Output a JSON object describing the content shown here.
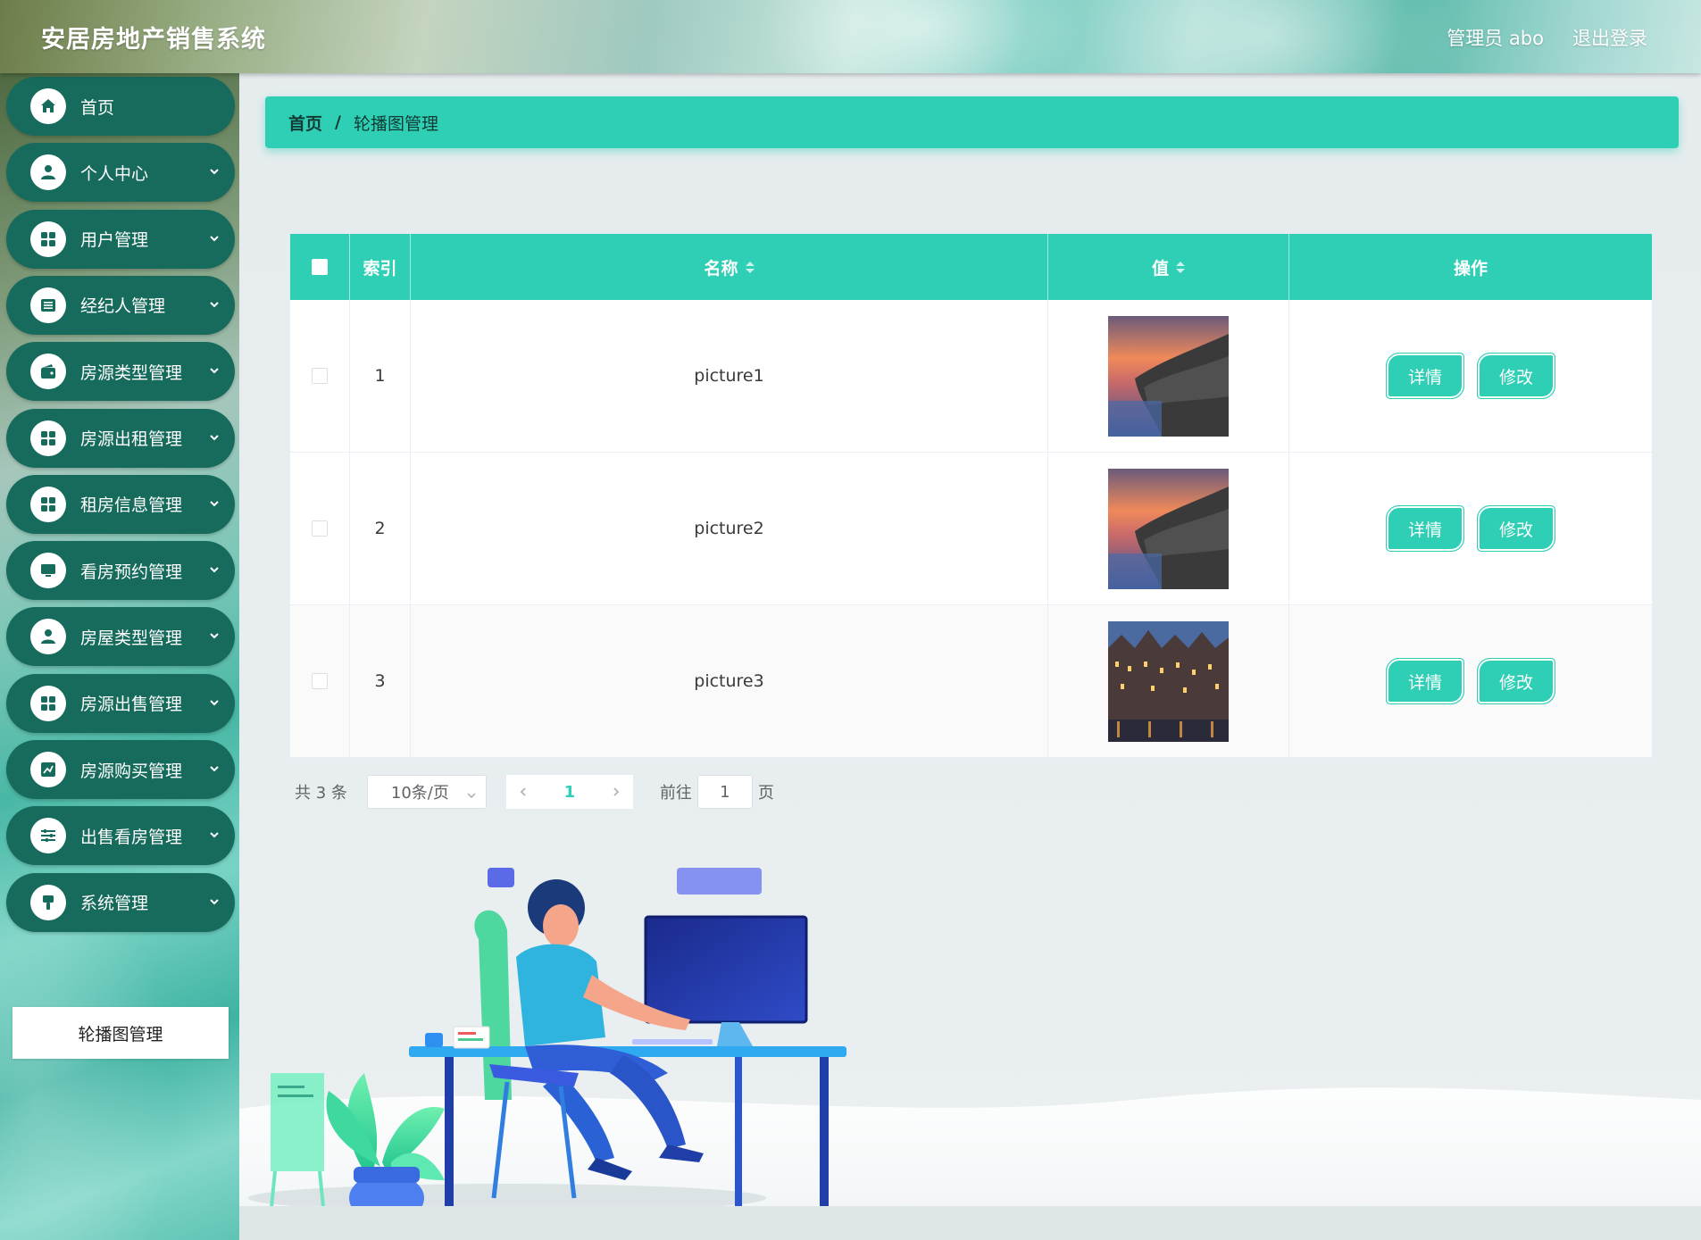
{
  "header": {
    "title": "安居房地产销售系统",
    "user_label": "管理员 abo",
    "logout_label": "退出登录"
  },
  "sidebar": {
    "items": [
      {
        "label": "首页",
        "icon": "home-icon",
        "expandable": false
      },
      {
        "label": "个人中心",
        "icon": "user-icon",
        "expandable": true
      },
      {
        "label": "用户管理",
        "icon": "grid-icon",
        "expandable": true
      },
      {
        "label": "经纪人管理",
        "icon": "list-icon",
        "expandable": true
      },
      {
        "label": "房源类型管理",
        "icon": "wallet-icon",
        "expandable": true
      },
      {
        "label": "房源出租管理",
        "icon": "grid-icon",
        "expandable": true
      },
      {
        "label": "租房信息管理",
        "icon": "grid-icon",
        "expandable": true
      },
      {
        "label": "看房预约管理",
        "icon": "monitor-icon",
        "expandable": true
      },
      {
        "label": "房屋类型管理",
        "icon": "user-icon",
        "expandable": true
      },
      {
        "label": "房源出售管理",
        "icon": "grid-icon",
        "expandable": true
      },
      {
        "label": "房源购买管理",
        "icon": "chart-icon",
        "expandable": true
      },
      {
        "label": "出售看房管理",
        "icon": "sliders-icon",
        "expandable": true
      },
      {
        "label": "系统管理",
        "icon": "brush-icon",
        "expandable": true
      }
    ],
    "submenu": {
      "label": "轮播图管理"
    }
  },
  "breadcrumb": {
    "home": "首页",
    "separator": "/",
    "current": "轮播图管理"
  },
  "table": {
    "headers": {
      "index": "索引",
      "name": "名称",
      "value": "值",
      "ops": "操作"
    },
    "rows": [
      {
        "index": "1",
        "name": "picture1",
        "image": "sunset-cliff"
      },
      {
        "index": "2",
        "name": "picture2",
        "image": "sunset-cliff"
      },
      {
        "index": "3",
        "name": "picture3",
        "image": "night-houses"
      }
    ],
    "detail_label": "详情",
    "edit_label": "修改"
  },
  "pagination": {
    "total_label": "共 3 条",
    "page_size": "10条/页",
    "current_page": "1",
    "goto_prefix": "前往",
    "goto_value": "1",
    "goto_suffix": "页"
  },
  "colors": {
    "accent": "#2fcfb5",
    "sidebar_item": "#166b5c"
  }
}
